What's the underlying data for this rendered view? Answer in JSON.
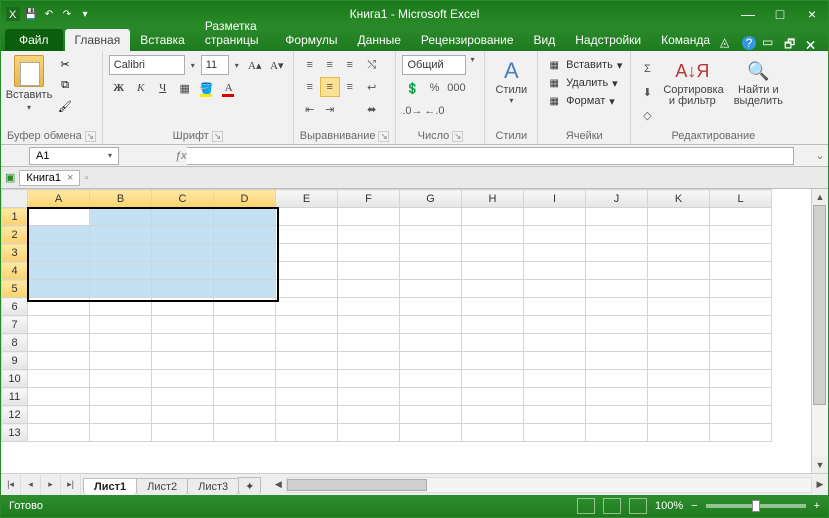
{
  "title": "Книга1 - Microsoft Excel",
  "tabs": {
    "file": "Файл",
    "home": "Главная",
    "insert": "Вставка",
    "layout": "Разметка страницы",
    "formulas": "Формулы",
    "data": "Данные",
    "review": "Рецензирование",
    "view": "Вид",
    "addins": "Надстройки",
    "team": "Команда"
  },
  "groups": {
    "clipboard": "Буфер обмена",
    "font": "Шрифт",
    "align": "Выравнивание",
    "number": "Число",
    "styles": "Стили",
    "cells": "Ячейки",
    "editing": "Редактирование"
  },
  "clipboard": {
    "paste": "Вставить"
  },
  "font": {
    "name": "Calibri",
    "size": "11"
  },
  "number": {
    "format": "Общий"
  },
  "cells": {
    "insert": "Вставить",
    "delete": "Удалить",
    "format": "Формат"
  },
  "styles": {
    "styles": "Стили"
  },
  "editing": {
    "sort": "Сортировка и фильтр",
    "find": "Найти и выделить"
  },
  "namebox": "A1",
  "doc": {
    "name": "Книга1"
  },
  "columns": [
    "A",
    "B",
    "C",
    "D",
    "E",
    "F",
    "G",
    "H",
    "I",
    "J",
    "K",
    "L"
  ],
  "rows": [
    "1",
    "2",
    "3",
    "4",
    "5",
    "6",
    "7",
    "8",
    "9",
    "10",
    "11",
    "12",
    "13"
  ],
  "selection": {
    "startCol": 0,
    "endCol": 3,
    "startRow": 0,
    "endRow": 4,
    "activeCol": 0,
    "activeRow": 0
  },
  "sheets": {
    "s1": "Лист1",
    "s2": "Лист2",
    "s3": "Лист3"
  },
  "status": {
    "ready": "Готово",
    "zoom": "100%"
  },
  "chart_data": null
}
